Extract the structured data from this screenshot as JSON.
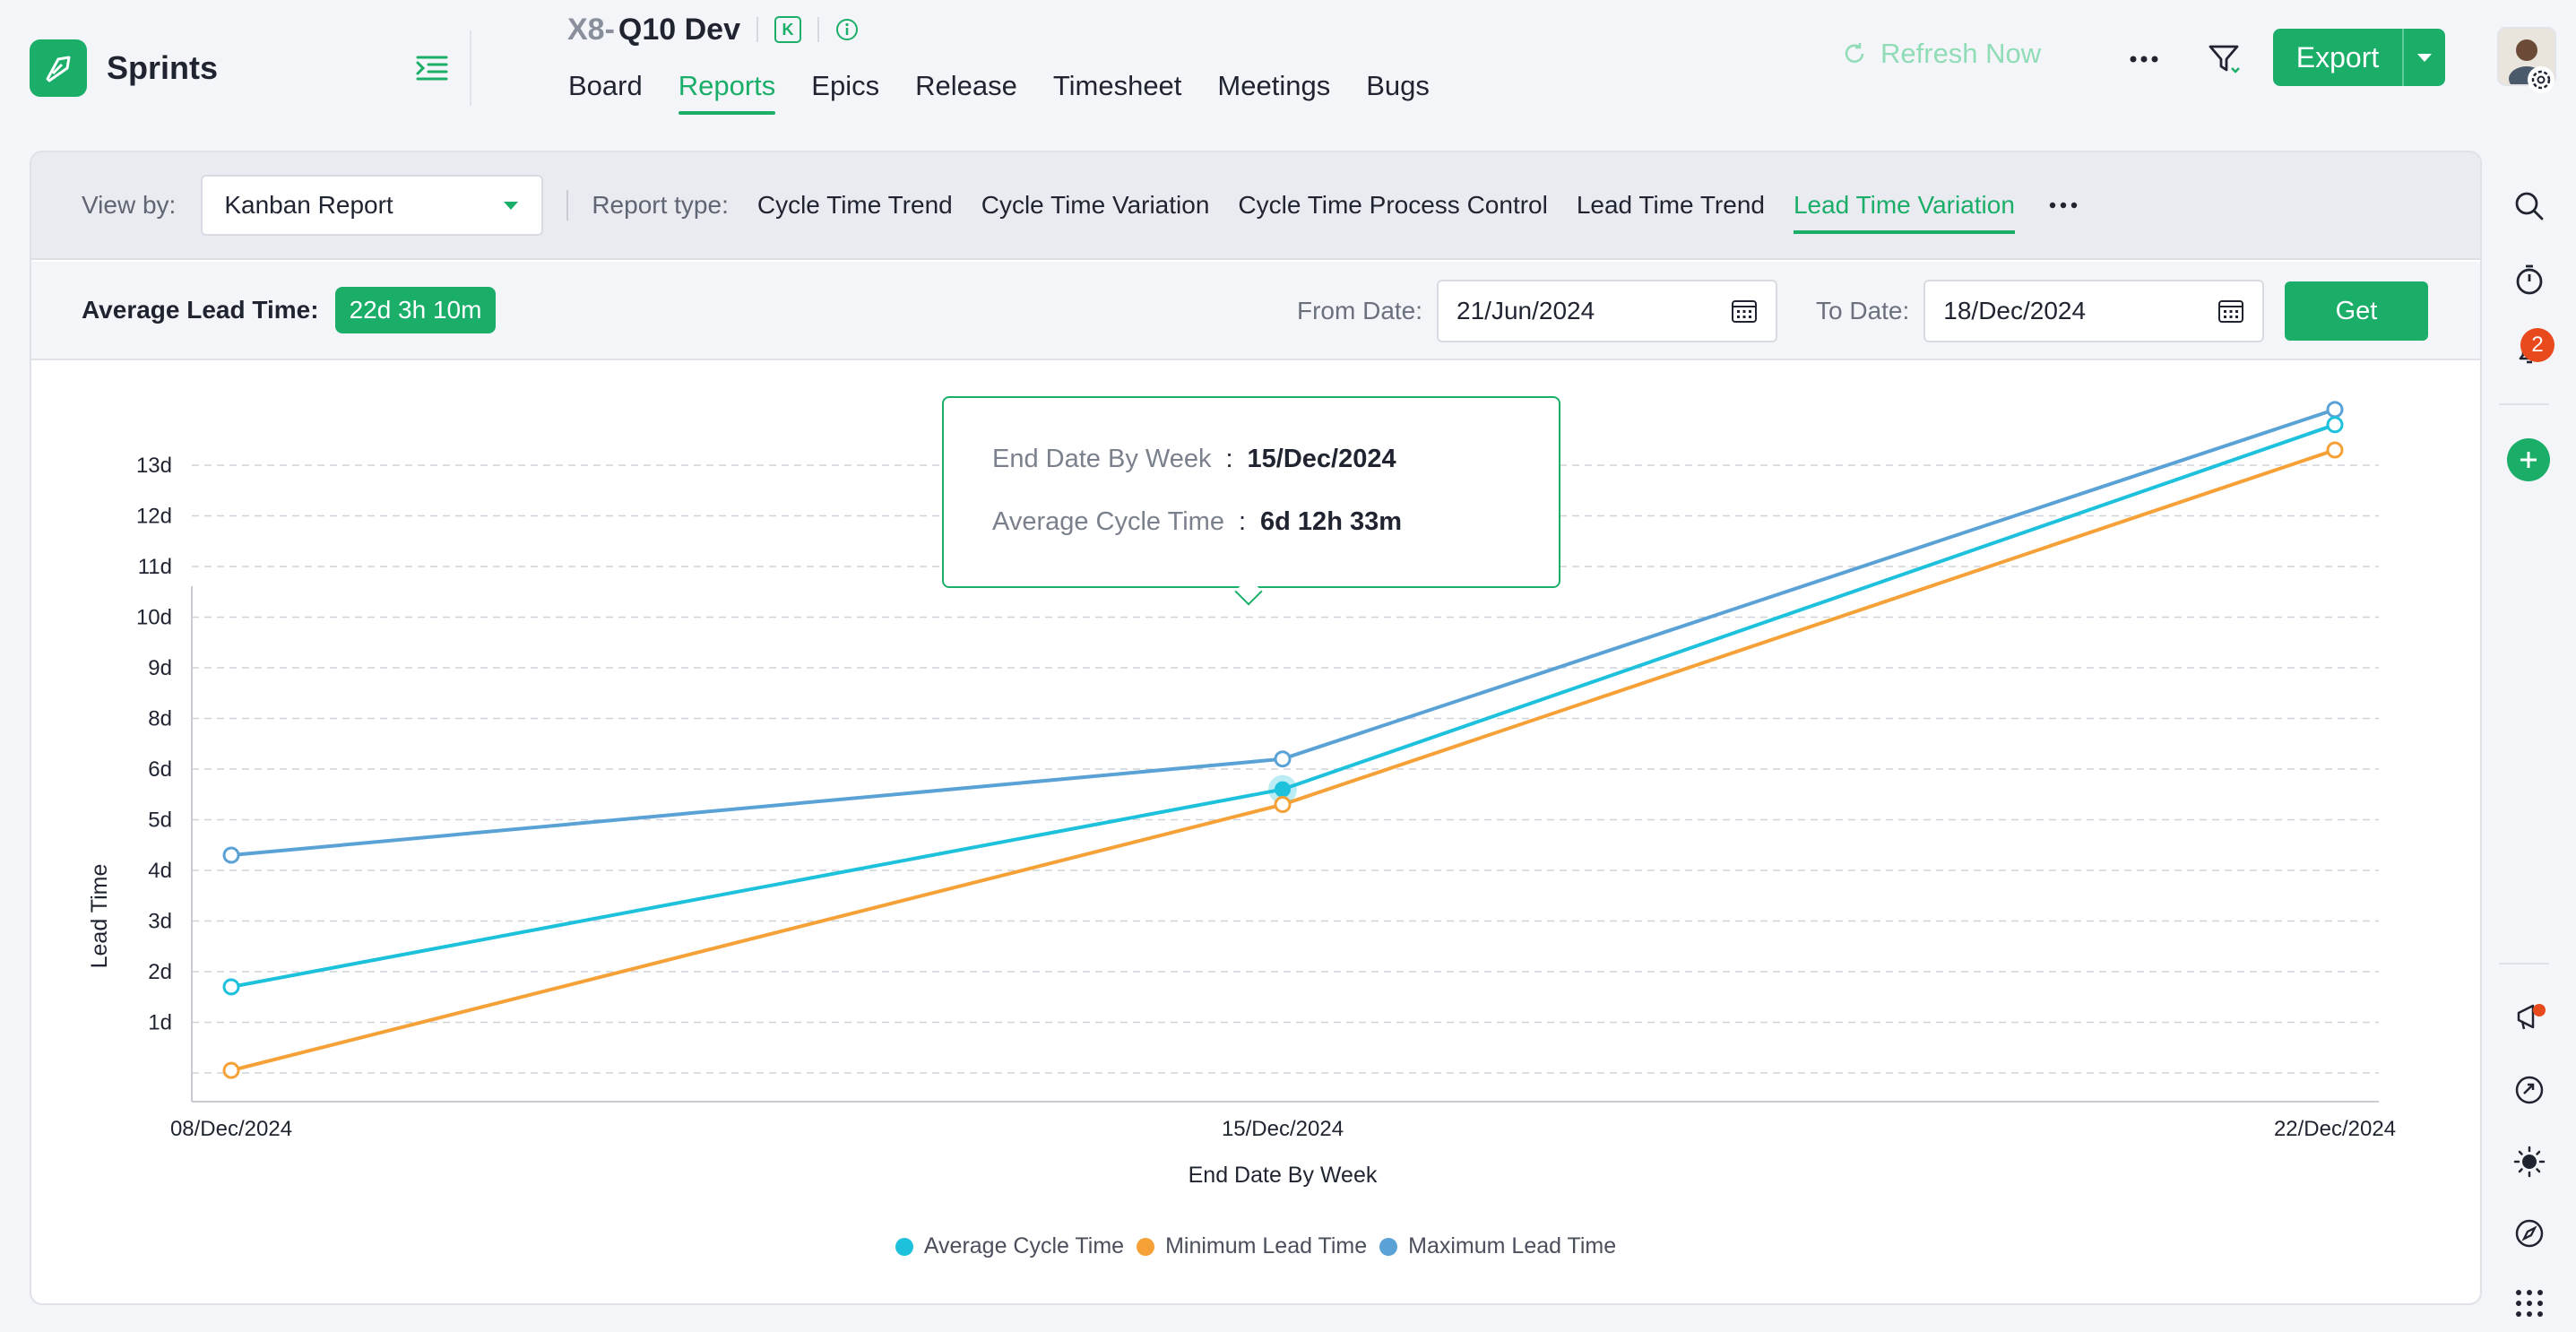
{
  "app": {
    "name": "Sprints"
  },
  "project": {
    "prefix": "X8-",
    "name": "Q10 Dev",
    "badge": "K"
  },
  "nav": {
    "items": [
      "Board",
      "Reports",
      "Epics",
      "Release",
      "Timesheet",
      "Meetings",
      "Bugs"
    ],
    "active": "Reports"
  },
  "header": {
    "refresh_label": "Refresh Now",
    "export_label": "Export"
  },
  "notifications": {
    "count": "2"
  },
  "viewbar": {
    "view_by_label": "View by:",
    "view_by_value": "Kanban Report",
    "report_type_label": "Report type:",
    "report_types": [
      "Cycle Time Trend",
      "Cycle Time Variation",
      "Cycle Time Process Control",
      "Lead Time Trend",
      "Lead Time Variation"
    ],
    "active_report": "Lead Time Variation"
  },
  "stats": {
    "avg_lead_label": "Average Lead Time:",
    "avg_lead_value": "22d 3h 10m",
    "from_label": "From Date:",
    "from_value": "21/Jun/2024",
    "to_label": "To Date:",
    "to_value": "18/Dec/2024",
    "get_label": "Get"
  },
  "tooltip": {
    "row1_key": "End Date By Week",
    "row1_val": "15/Dec/2024",
    "row2_key": "Average Cycle Time",
    "row2_val": "6d 12h 33m"
  },
  "colors": {
    "accent": "#1aae68",
    "avg": "#1ec1dc",
    "min": "#f5a137",
    "max": "#5aa2d6"
  },
  "chart_data": {
    "type": "line",
    "xlabel": "End Date By Week",
    "ylabel": "Lead Time",
    "categories": [
      "08/Dec/2024",
      "15/Dec/2024",
      "22/Dec/2024"
    ],
    "y_ticks": [
      "1d",
      "2d",
      "3d",
      "4d",
      "5d",
      "6d",
      "8d",
      "9d",
      "10d",
      "11d",
      "12d",
      "13d"
    ],
    "grid": true,
    "legend_position": "bottom",
    "series": [
      {
        "name": "Average Cycle Time",
        "color": "#1ec1dc",
        "values": [
          1.7,
          5.6,
          12.8
        ]
      },
      {
        "name": "Minimum Lead Time",
        "color": "#f5a137",
        "values": [
          0.05,
          5.3,
          12.3
        ]
      },
      {
        "name": "Maximum Lead Time",
        "color": "#5aa2d6",
        "values": [
          4.3,
          6.2,
          13.1
        ]
      }
    ],
    "highlighted_point": {
      "series": "Average Cycle Time",
      "category": "15/Dec/2024"
    }
  }
}
